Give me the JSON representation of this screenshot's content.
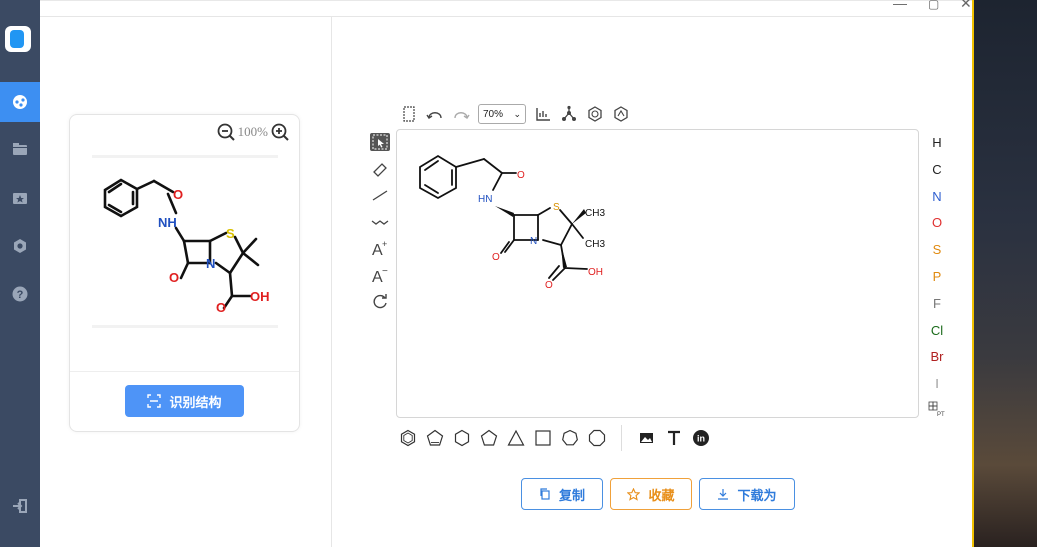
{
  "window": {
    "minimize": "—",
    "maximize": "▢",
    "close": "✕"
  },
  "nav": {
    "items": [
      {
        "name": "recognize",
        "icon": "molecule-icon",
        "active": true
      },
      {
        "name": "history",
        "icon": "folder-icon",
        "active": false
      },
      {
        "name": "favorites",
        "icon": "star-folder-icon",
        "active": false
      },
      {
        "name": "settings",
        "icon": "gear-icon",
        "active": false
      },
      {
        "name": "help",
        "icon": "help-icon",
        "active": false
      }
    ],
    "logout_icon": "logout-icon"
  },
  "preview": {
    "zoom_level": "100%",
    "recognize_label": "识别结构"
  },
  "editor": {
    "zoom_select": "70%",
    "atoms": [
      {
        "symbol": "H",
        "color": "#222222"
      },
      {
        "symbol": "C",
        "color": "#222222"
      },
      {
        "symbol": "N",
        "color": "#3060d0"
      },
      {
        "symbol": "O",
        "color": "#e03030"
      },
      {
        "symbol": "S",
        "color": "#e08a10"
      },
      {
        "symbol": "P",
        "color": "#e08a10"
      },
      {
        "symbol": "F",
        "color": "#777777"
      },
      {
        "symbol": "Cl",
        "color": "#1a6a1a"
      },
      {
        "symbol": "Br",
        "color": "#b02020"
      },
      {
        "symbol": "I",
        "color": "#999999"
      }
    ],
    "periodic_table_label": "PT"
  },
  "molecule": {
    "labels": {
      "nh": "HN",
      "nh_preview": "NH",
      "o1": "O",
      "o2": "O",
      "o3": "O",
      "s": "S",
      "n": "N",
      "ch3a": "CH3",
      "ch3b": "CH3",
      "oh": "OH"
    }
  },
  "actions": {
    "copy": "复制",
    "favorite": "收藏",
    "download": "下载为"
  },
  "colors": {
    "accent": "#4e94f7",
    "nav_bg": "#3b4a63",
    "nav_active": "#3d8ff2",
    "favorite": "#f0a13a"
  }
}
